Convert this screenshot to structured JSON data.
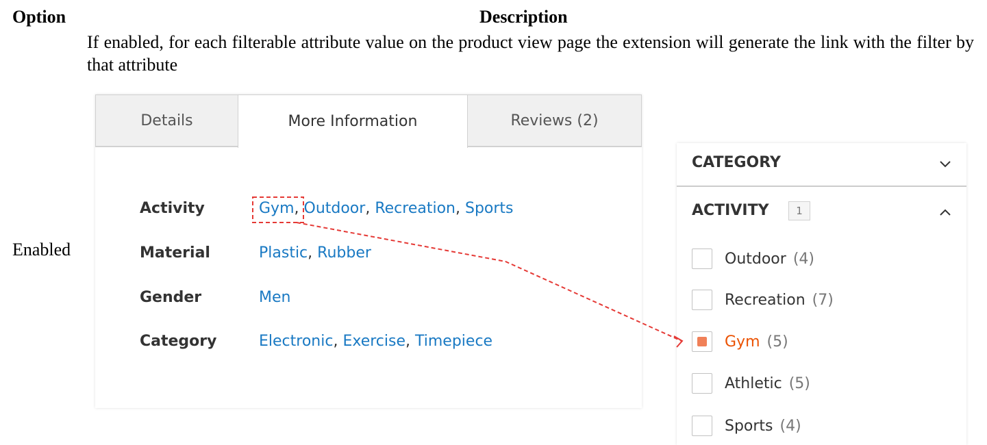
{
  "table": {
    "header_option": "Option",
    "header_description": "Description",
    "option_value": "Enabled",
    "description": "If enabled, for each filterable attribute value on the product view page the extension will generate the link with the filter by that attribute"
  },
  "product_tabs": {
    "tabs": [
      {
        "label": "Details"
      },
      {
        "label": "More Information"
      },
      {
        "label": "Reviews (2)"
      }
    ]
  },
  "attributes": [
    {
      "label": "Activity",
      "values": [
        "Gym",
        "Outdoor",
        "Recreation",
        "Sports"
      ]
    },
    {
      "label": "Material",
      "values": [
        "Plastic",
        "Rubber"
      ]
    },
    {
      "label": "Gender",
      "values": [
        "Men"
      ]
    },
    {
      "label": "Category",
      "values": [
        "Electronic",
        "Exercise",
        "Timepiece"
      ]
    }
  ],
  "filters": {
    "category_title": "CATEGORY",
    "activity_title": "ACTIVITY",
    "activity_badge": "1",
    "options": [
      {
        "label": "Outdoor",
        "count": "(4)",
        "checked": false
      },
      {
        "label": "Recreation",
        "count": "(7)",
        "checked": false
      },
      {
        "label": "Gym",
        "count": "(5)",
        "checked": true
      },
      {
        "label": "Athletic",
        "count": "(5)",
        "checked": false
      },
      {
        "label": "Sports",
        "count": "(4)",
        "checked": false
      }
    ]
  },
  "colors": {
    "link": "#1979c3",
    "active_filter": "#eb5202",
    "annotation": "#e53935"
  },
  "icons": {
    "category_toggle": "chevron-down-icon",
    "activity_toggle": "chevron-up-icon",
    "annotation": "dashed-arrow"
  }
}
